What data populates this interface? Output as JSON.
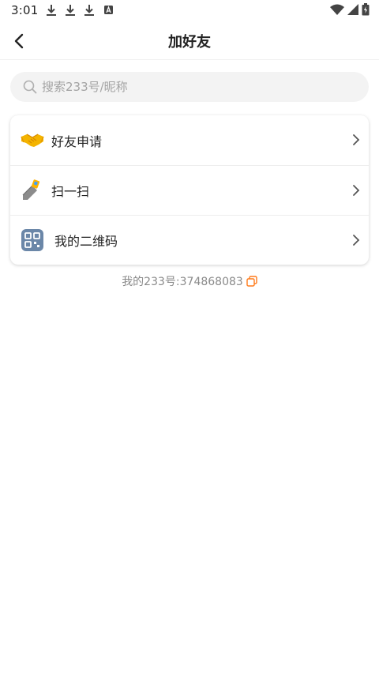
{
  "status_bar": {
    "time": "3:01",
    "notifications": [
      "download-icon",
      "download-icon",
      "download-icon",
      "font-app-icon"
    ],
    "right_icons": [
      "wifi-icon",
      "signal-icon",
      "battery-icon"
    ]
  },
  "header": {
    "title": "加好友",
    "back_icon": "back-arrow-icon"
  },
  "search": {
    "placeholder": "搜索233号/昵称",
    "value": ""
  },
  "menu": {
    "items": [
      {
        "label": "好友申请",
        "icon": "handshake-icon"
      },
      {
        "label": "扫一扫",
        "icon": "scanner-icon"
      },
      {
        "label": "我的二维码",
        "icon": "qr-code-icon"
      }
    ]
  },
  "my_id": {
    "text": "我的233号:374868083",
    "copy_icon": "copy-icon"
  },
  "colors": {
    "accent": "#ff7a1a",
    "search_bg": "#f3f3f3",
    "muted_text": "#8a8a8a"
  }
}
